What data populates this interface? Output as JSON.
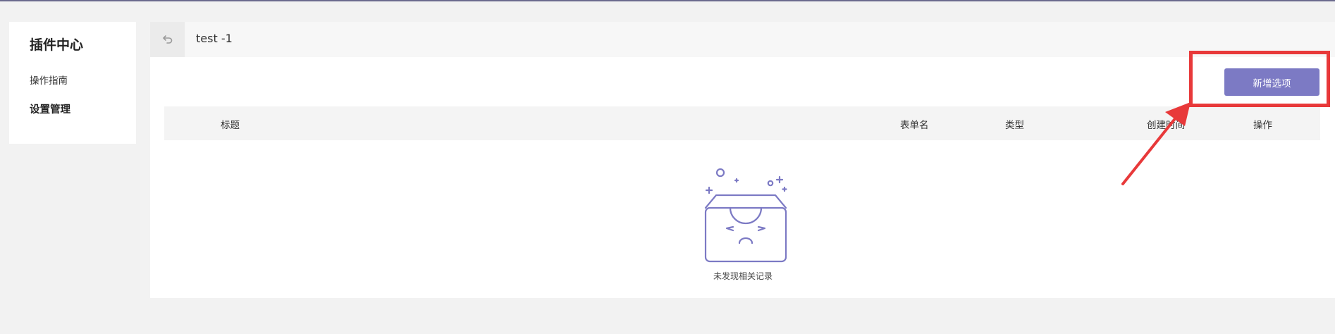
{
  "sidebar": {
    "title": "插件中心",
    "items": [
      {
        "label": "操作指南"
      },
      {
        "label": "设置管理"
      }
    ]
  },
  "header": {
    "back_icon": "back-arrow-icon",
    "title": "test -1"
  },
  "toolbar": {
    "add_label": "新增选项"
  },
  "table": {
    "columns": [
      "标题",
      "表单名",
      "类型",
      "创建时间",
      "操作"
    ]
  },
  "empty_state": {
    "icon": "empty-box-icon",
    "text": "未发现相关记录"
  },
  "colors": {
    "accent": "#7c7ac4",
    "annotation": "#e8393a",
    "background": "#f2f2f2"
  }
}
